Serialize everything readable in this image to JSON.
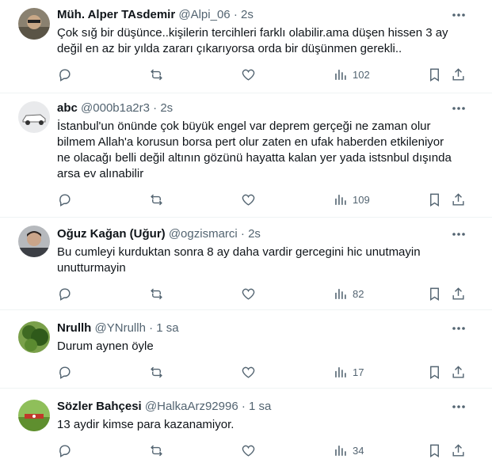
{
  "tweets": [
    {
      "name": "Müh. Alper TAsdemir",
      "handle": "@Alpi_06",
      "separator": "·",
      "time": "2s",
      "text": [
        "Çok sığ bir düşünce..kişilerin tercihleri farklı olabilir.ama düşen hissen 3 ay",
        "değil en az bir yılda zararı çıkarıyorsa orda bir düşünmen gerekli.."
      ],
      "views": "102"
    },
    {
      "name": "abc",
      "handle": "@000b1a2r3",
      "separator": "·",
      "time": "2s",
      "text": [
        "İstanbul'un önünde çok büyük engel var deprem gerçeği ne zaman olur",
        "bilmem Allah'a korusun borsa pert olur zaten en ufak haberden etkileniyor",
        "ne olacağı belli değil altının gözünü hayatta kalan yer yada istsnbul dışında",
        "arsa ev alınabilir"
      ],
      "views": "109"
    },
    {
      "name": "Oğuz Kağan (Uğur)",
      "handle": "@ogzismarci",
      "separator": "·",
      "time": "2s",
      "text": [
        "Bu cumleyi kurduktan sonra 8 ay daha vardir gercegini hic unutmayin",
        "unutturmayin"
      ],
      "views": "82"
    },
    {
      "name": "Nrullh",
      "handle": "@YNrullh",
      "separator": "·",
      "time": "1 sa",
      "text": [
        "Durum aynen öyle"
      ],
      "views": "17"
    },
    {
      "name": "Sözler Bahçesi",
      "handle": "@HalkaArz92996",
      "separator": "·",
      "time": "1 sa",
      "text": [
        "13 aydir kimse para kazanamiyor."
      ],
      "views": "34"
    }
  ],
  "icons": {
    "more": "more-icon",
    "reply": "reply-icon",
    "retweet": "retweet-icon",
    "like": "heart-icon",
    "views": "views-icon",
    "bookmark": "bookmark-icon",
    "share": "share-icon"
  },
  "colors": {
    "name": "#0f1419",
    "secondary": "#536471",
    "divider": "#eff3f4"
  }
}
